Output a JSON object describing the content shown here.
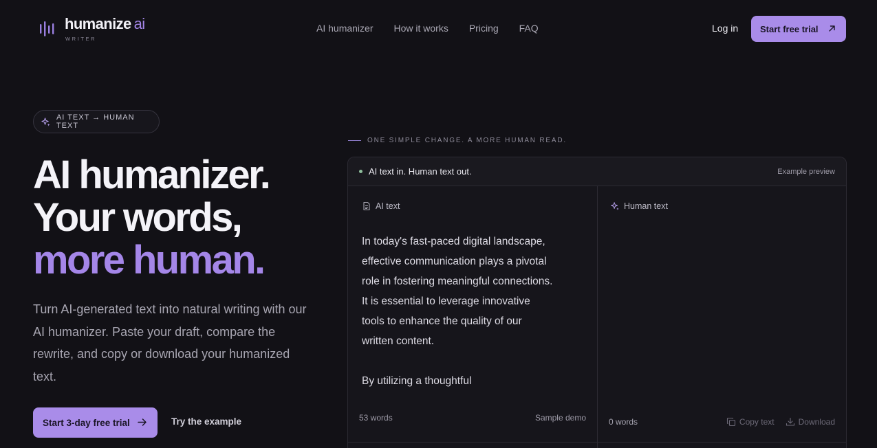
{
  "brand": {
    "name": "humanize",
    "suffix": "ai",
    "tagline": "WRITER"
  },
  "nav": {
    "items": [
      {
        "label": "AI humanizer"
      },
      {
        "label": "How it works"
      },
      {
        "label": "Pricing"
      },
      {
        "label": "FAQ"
      }
    ]
  },
  "header": {
    "login_label": "Log in",
    "trial_label": "Start free trial"
  },
  "hero": {
    "badge": "AI TEXT → HUMAN TEXT",
    "title_line1": "AI humanizer.",
    "title_line2": "Your words,",
    "title_line3": "more human.",
    "description": "Turn AI-generated text into natural writing with our AI humanizer. Paste your draft, compare the rewrite, and copy or download your humanized text.",
    "primary_cta": "Start 3-day free trial",
    "secondary_cta": "Try the example"
  },
  "preview": {
    "tagline": "ONE SIMPLE CHANGE. A MORE HUMAN READ.",
    "header_title": "AI text in. Human text out.",
    "header_meta": "Example preview",
    "left": {
      "label": "AI text",
      "paragraph1": "In today's fast-paced digital landscape, effective communication plays a pivotal role in fostering meaningful connections. It is essential to leverage innovative tools to enhance the quality of our written content.",
      "paragraph2": "By utilizing a thoughtful",
      "word_count": "53 words",
      "sample_label": "Sample demo"
    },
    "right": {
      "label": "Human text",
      "word_count": "0 words",
      "copy_label": "Copy text",
      "download_label": "Download"
    }
  },
  "colors": {
    "accent": "#a98ce9",
    "accent_text": "#a486e8",
    "background": "#121116",
    "status_dot": "#8fbf9d"
  },
  "icons": [
    "logo-bars-icon",
    "arrow-up-right-icon",
    "sparkle-icon",
    "document-icon",
    "copy-icon",
    "download-icon",
    "arrow-right-icon"
  ]
}
